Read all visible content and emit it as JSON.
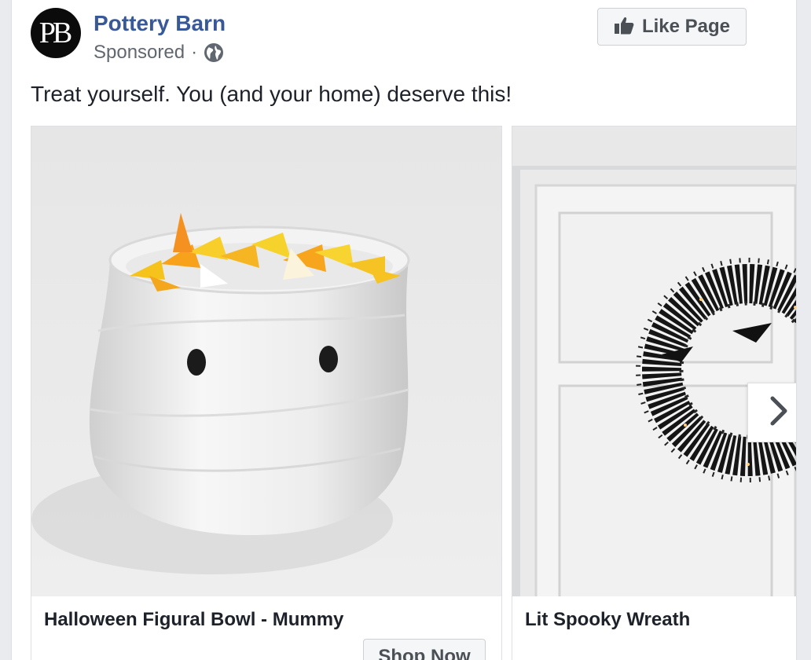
{
  "header": {
    "avatar_initials": "PB",
    "page_name": "Pottery Barn",
    "sponsored_label": "Sponsored",
    "separator": "·",
    "privacy_icon": "globe-icon",
    "like_button_label": "Like Page",
    "like_icon": "thumbs-up-icon"
  },
  "post": {
    "text": "Treat yourself. You (and your home) deserve this!"
  },
  "carousel": {
    "cards": [
      {
        "title": "Halloween Figural Bowl - Mummy",
        "cta_label": "Shop Now"
      },
      {
        "title": "Lit Spooky Wreath"
      }
    ],
    "next_icon": "chevron-right-icon"
  },
  "colors": {
    "page_name": "#385898",
    "secondary_text": "#616770",
    "button_text": "#4b4f56",
    "border": "#dddfe2",
    "background": "#e9ebee"
  }
}
